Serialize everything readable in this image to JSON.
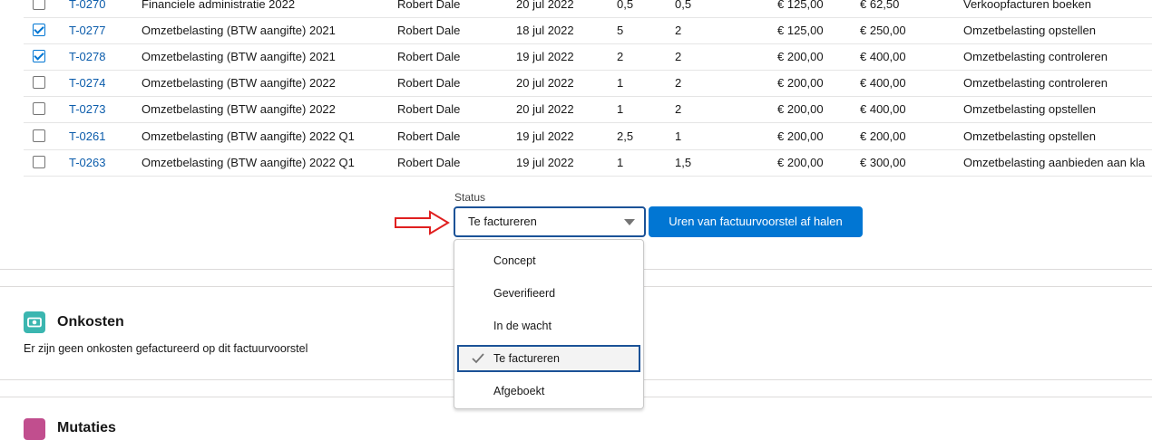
{
  "table": {
    "rows": [
      {
        "checked": false,
        "id": "T-0270",
        "description": "Financiele administratie 2022",
        "employee": "Robert Dale",
        "date": "20 jul 2022",
        "hours": "0,5",
        "invoice_hours": "0,5",
        "rate": "€ 125,00",
        "amount": "€ 62,50",
        "activity": "Verkoopfacturen boeken"
      },
      {
        "checked": true,
        "id": "T-0277",
        "description": "Omzetbelasting (BTW aangifte) 2021",
        "employee": "Robert Dale",
        "date": "18 jul 2022",
        "hours": "5",
        "invoice_hours": "2",
        "rate": "€ 125,00",
        "amount": "€ 250,00",
        "activity": "Omzetbelasting opstellen"
      },
      {
        "checked": true,
        "id": "T-0278",
        "description": "Omzetbelasting (BTW aangifte) 2021",
        "employee": "Robert Dale",
        "date": "19 jul 2022",
        "hours": "2",
        "invoice_hours": "2",
        "rate": "€ 200,00",
        "amount": "€ 400,00",
        "activity": "Omzetbelasting controleren"
      },
      {
        "checked": false,
        "id": "T-0274",
        "description": "Omzetbelasting (BTW aangifte) 2022",
        "employee": "Robert Dale",
        "date": "20 jul 2022",
        "hours": "1",
        "invoice_hours": "2",
        "rate": "€ 200,00",
        "amount": "€ 400,00",
        "activity": "Omzetbelasting controleren"
      },
      {
        "checked": false,
        "id": "T-0273",
        "description": "Omzetbelasting (BTW aangifte) 2022",
        "employee": "Robert Dale",
        "date": "20 jul 2022",
        "hours": "1",
        "invoice_hours": "2",
        "rate": "€ 200,00",
        "amount": "€ 400,00",
        "activity": "Omzetbelasting opstellen"
      },
      {
        "checked": false,
        "id": "T-0261",
        "description": "Omzetbelasting (BTW aangifte) 2022 Q1",
        "employee": "Robert Dale",
        "date": "19 jul 2022",
        "hours": "2,5",
        "invoice_hours": "1",
        "rate": "€ 200,00",
        "amount": "€ 200,00",
        "activity": "Omzetbelasting opstellen"
      },
      {
        "checked": false,
        "id": "T-0263",
        "description": "Omzetbelasting (BTW aangifte) 2022 Q1",
        "employee": "Robert Dale",
        "date": "19 jul 2022",
        "hours": "1",
        "invoice_hours": "1,5",
        "rate": "€ 200,00",
        "amount": "€ 300,00",
        "activity": "Omzetbelasting aanbieden aan kla"
      }
    ]
  },
  "status": {
    "label": "Status",
    "value": "Te factureren",
    "options": [
      "Concept",
      "Geverifieerd",
      "In de wacht",
      "Te factureren",
      "Afgeboekt"
    ],
    "selected_index": 3
  },
  "action_button": "Uren van factuurvoorstel af halen",
  "onkosten": {
    "title": "Onkosten",
    "text": "Er zijn geen onkosten gefactureerd op dit factuurvoorstel",
    "icon": "expense-icon"
  },
  "next_section": {
    "title": "Mutaties",
    "icon": "section-icon"
  },
  "colors": {
    "brand": "#0176d3",
    "link": "#0b5cab",
    "focus": "#1b5297",
    "onkosten_icon": "#3bb6b0",
    "next_icon": "#c14e8e",
    "annotation_arrow": "#e02020"
  }
}
